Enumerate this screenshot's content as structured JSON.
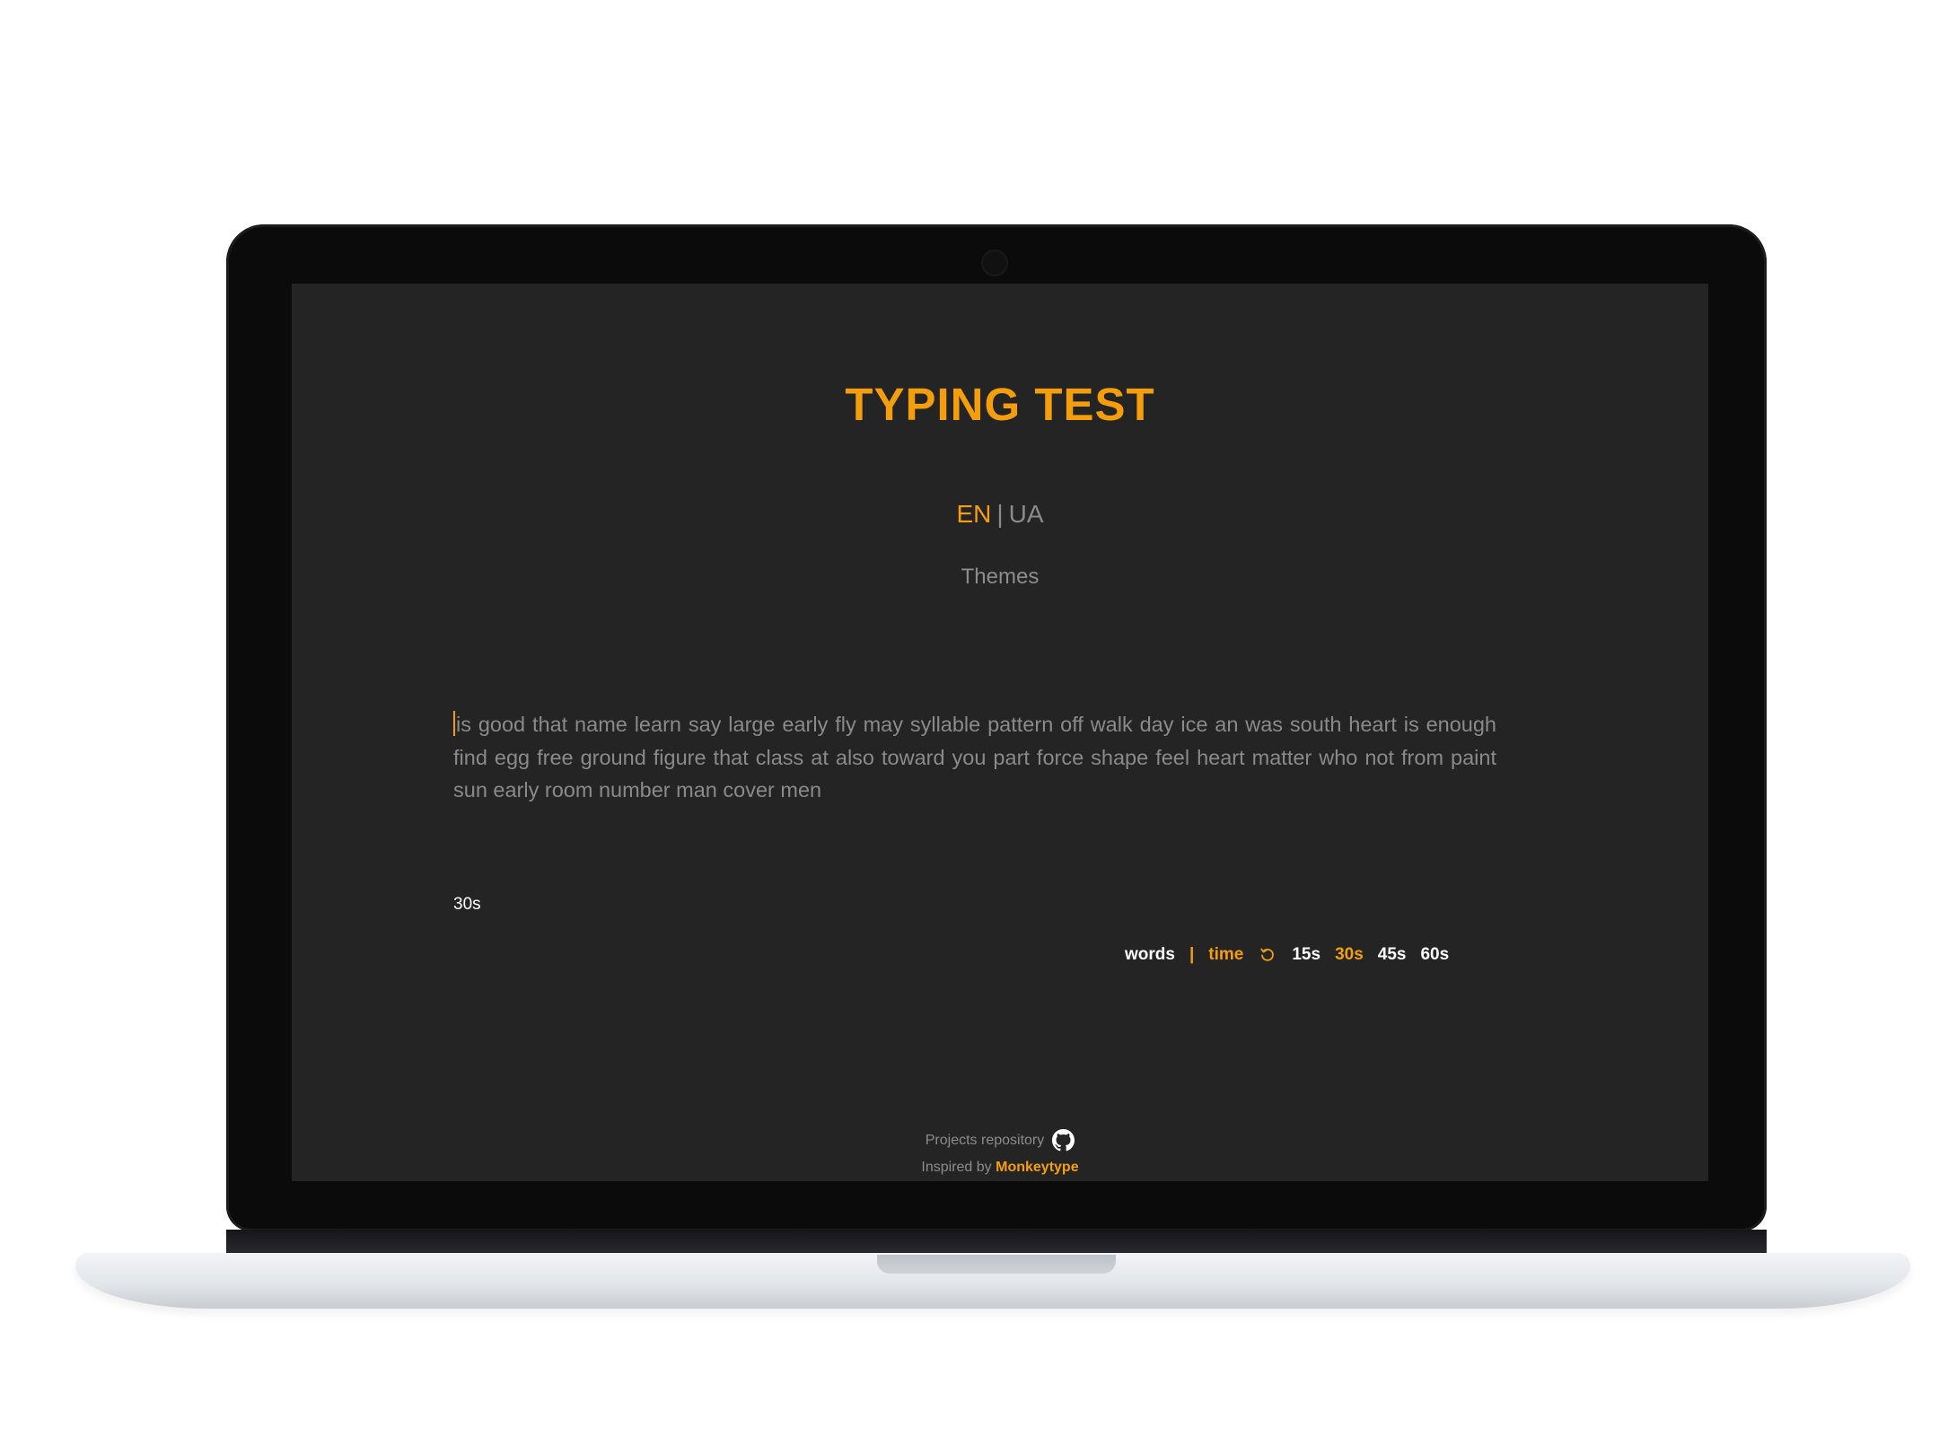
{
  "app": {
    "title": "TYPING TEST"
  },
  "language": {
    "options": [
      "EN",
      "UA"
    ],
    "selected": "EN",
    "separator": "|"
  },
  "themes": {
    "label": "Themes"
  },
  "test": {
    "words_text": "is good that name learn say large early fly may syllable pattern off walk day ice an was south heart is enough find egg free ground figure that class at also toward you part force shape feel heart matter who not from paint sun early room number man cover men",
    "timer": "30s"
  },
  "modes": {
    "words_label": "words",
    "divider": "|",
    "time_label": "time",
    "selected_mode": "time",
    "refresh_icon": "refresh-icon",
    "durations": [
      "15s",
      "30s",
      "45s",
      "60s"
    ],
    "selected_duration": "30s"
  },
  "footer": {
    "repo_label": "Projects repository",
    "repo_icon": "github-icon",
    "inspired_prefix": "Inspired by",
    "inspired_link": "Monkeytype"
  },
  "colors": {
    "accent": "#f59e0b",
    "background": "#242424",
    "muted_text": "#8a8a8a"
  }
}
